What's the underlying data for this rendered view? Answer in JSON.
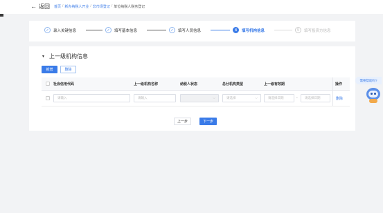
{
  "header": {
    "back_label": "返回",
    "breadcrumbs": [
      "首页",
      "新办纳税人开业",
      "非市场登记",
      "单位纳税人税务登记"
    ],
    "separator": "/"
  },
  "steps": [
    {
      "label": "录入关键信息",
      "state": "done",
      "mark": "✓"
    },
    {
      "label": "填写基本信息",
      "state": "done",
      "mark": "✓"
    },
    {
      "label": "填写人员信息",
      "state": "done",
      "mark": "✓"
    },
    {
      "label": "填写机构信息",
      "state": "active",
      "mark": "4"
    },
    {
      "label": "填写投资方信息",
      "state": "pending",
      "mark": "5"
    }
  ],
  "section": {
    "title": "上一级机构信息",
    "caret": "▼",
    "add_label": "新增",
    "delete_label": "删除"
  },
  "table": {
    "columns": [
      "社会信用代码",
      "上一级机构名称",
      "纳税人状态",
      "总分机构类型",
      "上一级有效期",
      "操作"
    ],
    "row": {
      "credit_code_placeholder": "请输入",
      "name_placeholder": "请输入",
      "status_value": "",
      "type_placeholder": "请选择",
      "start_date_placeholder": "请选择日期",
      "range_separator": "-",
      "end_date_placeholder": "请选择日期",
      "action_label": "删除"
    }
  },
  "footer": {
    "prev_label": "上一步",
    "next_label": "下一步"
  },
  "assistant": {
    "bubble_text": "需要帮助吗?"
  },
  "colors": {
    "primary": "#3a7be8",
    "background": "#f2f3f5"
  }
}
